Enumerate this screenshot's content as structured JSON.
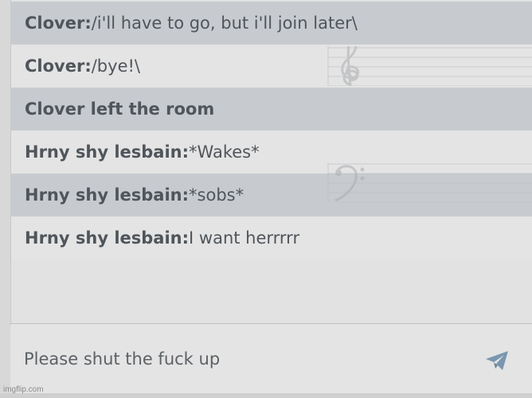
{
  "messages": [
    {
      "author": "Clover:",
      "text": " /i'll have to go, but i'll join later\\",
      "style": "dark"
    },
    {
      "author": "Clover:",
      "text": " /bye!\\",
      "style": "light"
    },
    {
      "author": "Clover left the room",
      "text": "",
      "style": "dark"
    },
    {
      "author": "Hrny shy lesbain:",
      "text": " *Wakes*",
      "style": "light"
    },
    {
      "author": "Hrny shy lesbain:",
      "text": " *sobs*",
      "style": "dark"
    },
    {
      "author": "Hrny shy lesbain:",
      "text": " I want herrrrr",
      "style": "light"
    }
  ],
  "composer": {
    "value": "Please shut the fuck up",
    "send_icon": "paper-plane-icon"
  },
  "watermark": "imgflip.com",
  "colors": {
    "dark_row": "#c7cbcf",
    "light_row": "#e4e4e4",
    "text": "#50555b",
    "send_icon": "#7a96b0"
  }
}
